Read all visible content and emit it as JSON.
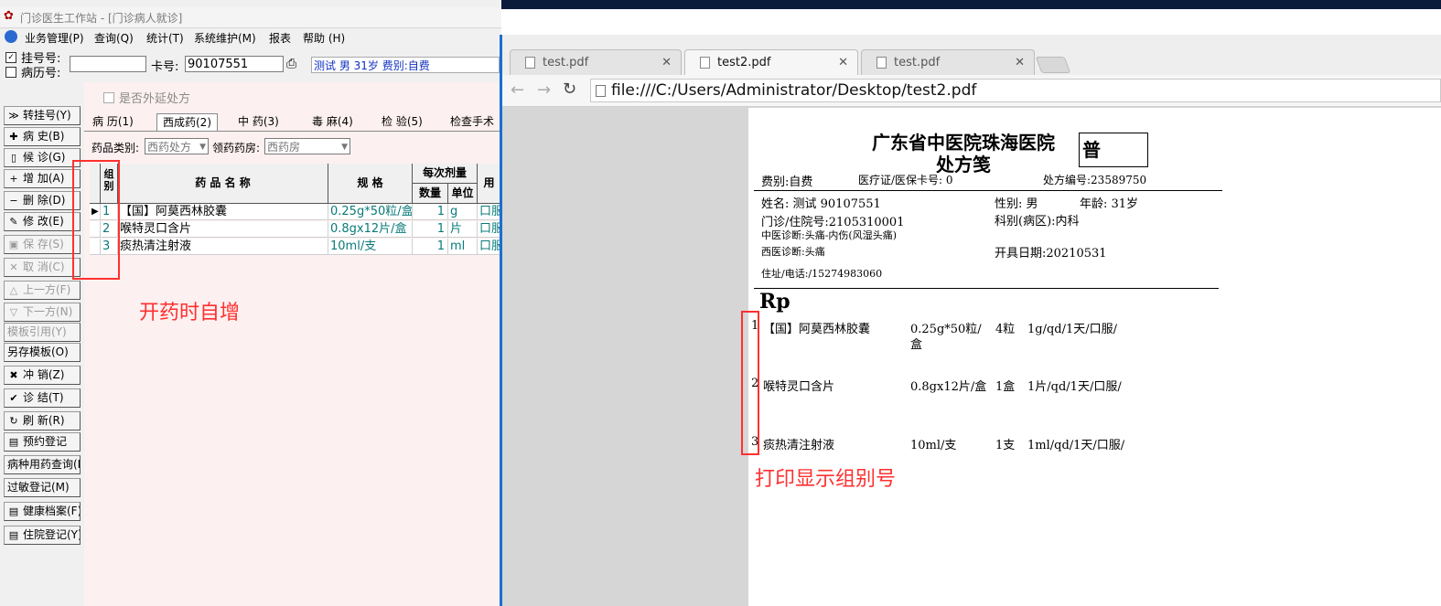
{
  "app": {
    "title": "门诊医生工作站 - [门诊病人就诊]",
    "menu": [
      "业务管理(P)",
      "查询(Q)",
      "统计(T)",
      "系统维护(M)",
      "报表",
      "帮助 (H)"
    ]
  },
  "patient_bar": {
    "reg_label": "挂号号:",
    "record_label": "病历号:",
    "card_label": "卡号:",
    "card_value": "90107551",
    "patient_info": "测试  男  31岁  费别:自费"
  },
  "side_buttons": [
    {
      "name": "transfer",
      "icon": "≫",
      "label": "转挂号(Y)",
      "disabled": false
    },
    {
      "name": "history",
      "icon": "✚",
      "label": "病    史(B)",
      "disabled": false
    },
    {
      "name": "waiting",
      "icon": "▯",
      "label": "候    诊(G)",
      "disabled": false
    },
    {
      "name": "add",
      "icon": "+",
      "label": "增    加(A)",
      "disabled": false
    },
    {
      "name": "delete",
      "icon": "−",
      "label": "删    除(D)",
      "disabled": false
    },
    {
      "name": "modify",
      "icon": "✎",
      "label": "修    改(E)",
      "disabled": false
    },
    {
      "name": "save",
      "icon": "▣",
      "label": "保    存(S)",
      "disabled": true
    },
    {
      "name": "cancel",
      "icon": "✕",
      "label": "取    消(C)",
      "disabled": true
    },
    {
      "name": "prev",
      "icon": "△",
      "label": "上一方(F)",
      "disabled": true
    },
    {
      "name": "next",
      "icon": "▽",
      "label": "下一方(N)",
      "disabled": true
    },
    {
      "name": "template-ref",
      "icon": "",
      "label": "模板引用(Y)",
      "disabled": true
    },
    {
      "name": "save-template",
      "icon": "",
      "label": "另存模板(O)",
      "disabled": false
    },
    {
      "name": "reverse",
      "icon": "✖",
      "label": "冲    销(Z)",
      "disabled": false
    },
    {
      "name": "finish",
      "icon": "✔",
      "label": "诊    结(T)",
      "disabled": false
    },
    {
      "name": "refresh",
      "icon": "↻",
      "label": "刷    新(R)",
      "disabled": false
    },
    {
      "name": "appointment",
      "icon": "▤",
      "label": "预约登记",
      "disabled": false
    },
    {
      "name": "disease-query",
      "icon": "",
      "label": "病种用药查询(N)",
      "disabled": false
    },
    {
      "name": "allergy",
      "icon": "",
      "label": "过敏登记(M)",
      "disabled": false
    },
    {
      "name": "health-file",
      "icon": "▤",
      "label": "健康档案(F)",
      "disabled": false
    },
    {
      "name": "inpatient",
      "icon": "▤",
      "label": "住院登记(Y)",
      "disabled": false
    }
  ],
  "panel": {
    "extended_label": "是否外延处方",
    "tabs": [
      "病  历(1)",
      "西成药(2)",
      "中  药(3)",
      "毒  麻(4)",
      "检  验(5)",
      "检查手术"
    ],
    "drug_type_label": "药品类别:",
    "drug_type_value": "西药处方",
    "pharmacy_label": "领药药房:",
    "pharmacy_value": "西药房",
    "headers": {
      "group": "组别",
      "name": "药 品 名 称",
      "spec": "规    格",
      "dose": "每次剂量",
      "qty": "数量",
      "unit": "单位",
      "usage": "用"
    },
    "rows": [
      {
        "group": "1",
        "name": "【国】阿莫西林胶囊",
        "spec": "0.25g*50粒/盒",
        "qty": "1",
        "unit": "g",
        "usage": "口服"
      },
      {
        "group": "2",
        "name": "喉特灵口含片",
        "spec": "0.8gx12片/盒",
        "qty": "1",
        "unit": "片",
        "usage": "口服"
      },
      {
        "group": "3",
        "name": "痰热清注射液",
        "spec": "10ml/支",
        "qty": "1",
        "unit": "ml",
        "usage": "口服"
      }
    ]
  },
  "annotations": {
    "left": "开药时自增",
    "right": "打印显示组别号"
  },
  "browser": {
    "tabs": [
      "test.pdf",
      "test2.pdf",
      "test.pdf"
    ],
    "active_tab": 1,
    "url": "file:///C:/Users/Administrator/Desktop/test2.pdf"
  },
  "prescription": {
    "hospital": "广东省中医院珠海医院",
    "title": "处方笺",
    "stamp": "普",
    "fee_type": "费别:自费",
    "insurance_label": "医疗证/医保卡号: 0",
    "rx_no": "处方编号:23589750",
    "name_line": "姓名:  测试   90107551",
    "gender": "性别:  男",
    "age": "年龄: 31岁",
    "clinic_no": "门诊/住院号:2105310001",
    "dept": "科别(病区):内科",
    "tcm_diag": "中医诊断:头痛-内伤(风湿头痛)",
    "wm_diag": "西医诊断:头痛",
    "date": "开具日期:20210531",
    "address": "住址/电话:/15274983060",
    "rp": "Rp",
    "items": [
      {
        "no": "1",
        "name": "【国】阿莫西林胶囊",
        "spec": "0.25g*50粒/",
        "spec2": "盒",
        "qty": "4粒",
        "usage": "1g/qd/1天/口服/"
      },
      {
        "no": "2",
        "name": "喉特灵口含片",
        "spec": "0.8gx12片/盒",
        "spec2": "",
        "qty": "1盒",
        "usage": "1片/qd/1天/口服/"
      },
      {
        "no": "3",
        "name": "痰热清注射液",
        "spec": "10ml/支",
        "spec2": "",
        "qty": "1支",
        "usage": "1ml/qd/1天/口服/"
      }
    ]
  }
}
